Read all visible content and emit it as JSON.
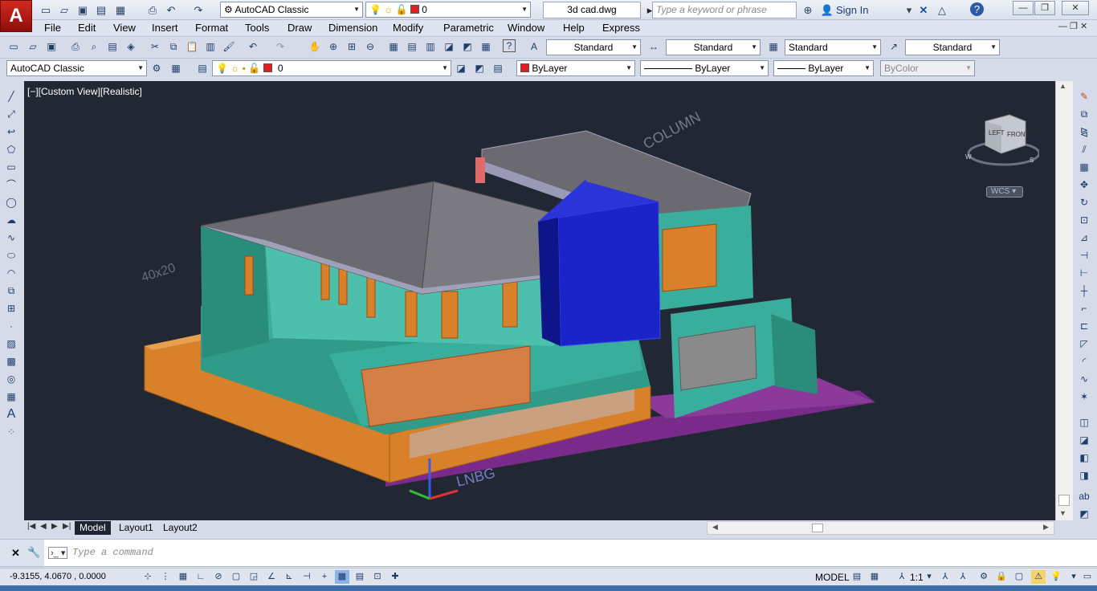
{
  "title_bar": {
    "workspace": "AutoCAD Classic",
    "layer": "0",
    "filename": "3d cad.dwg",
    "search_placeholder": "Type a keyword or phrase",
    "sign_in": "Sign In"
  },
  "menus": [
    "File",
    "Edit",
    "View",
    "Insert",
    "Format",
    "Tools",
    "Draw",
    "Dimension",
    "Modify",
    "Parametric",
    "Window",
    "Help",
    "Express"
  ],
  "styles_toolbar": {
    "text_style": "Standard",
    "dim_style": "Standard",
    "table_style": "Standard",
    "mleader_style": "Standard"
  },
  "layers_toolbar": {
    "workspace": "AutoCAD Classic",
    "layer": "0",
    "color": "ByLayer",
    "linetype": "ByLayer",
    "lineweight": "ByLayer",
    "plotstyle": "ByColor"
  },
  "viewport": {
    "label": "[−][Custom View][Realistic]",
    "navcube_top": "LEFT",
    "navcube_front": "FRONT",
    "compass_w": "W",
    "compass_s": "S",
    "wcs": "WCS"
  },
  "tabs": [
    "Model",
    "Layout1",
    "Layout2"
  ],
  "command_line": {
    "placeholder": "Type a command"
  },
  "status_bar": {
    "coordinates": "-9.3155, 4.0670 , 0.0000",
    "model": "MODEL",
    "scale": "1:1"
  },
  "colors": {
    "accent": "#c8231a",
    "viewport_bg": "#222833",
    "teal_wall": "#3aae9c",
    "orange_fence": "#d8802a",
    "blue_panel": "#1a24c8",
    "roof_grey": "#6a6a70",
    "ground_purple": "#7a2a8a"
  }
}
